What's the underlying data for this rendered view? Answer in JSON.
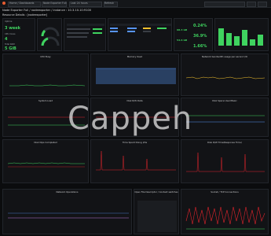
{
  "colors": {
    "green": "#3fd35f",
    "yellow": "#f2c12e",
    "red": "#e0242c",
    "orange": "#e65c30",
    "blue": "#5794f2",
    "purple": "#b877d9",
    "bg": "#0b0c0e",
    "panel": "#121316"
  },
  "topbar": {
    "items": [
      "Home / Dashboards",
      "Node Exporter Full",
      "Last 24 hours",
      "Refresh"
    ]
  },
  "breadcrumb": "Node Exporter Full  /  nodeexporter  /  instance : 10.3.10.10:9100",
  "row_title": "Resource Details : [nodeexporter]",
  "stats": {
    "uptime_label": "Uptime",
    "uptime_value": "3 week",
    "cpu_label": "CPU Cores",
    "cpu_value": "4",
    "ram_label": "Total RAM",
    "ram_value": "5 GiB",
    "pct1": "0.24%",
    "pct2": "36.9%",
    "pct3": "1.66%",
    "small1": "98.3 GB",
    "small2": "54.6 GB"
  },
  "panel_titles": [
    "CPU Busy",
    "Memory Used",
    "Network bandwidth usage per second I/O",
    "System Load",
    "Disk R/W Data",
    "Disk Space Used Basic",
    "Disk IOps Completed",
    "Time Spent Doing I/Os",
    "Disk R/W Time(Response Time)",
    "Network Operations",
    "Open File Descriptor / Context switches",
    "Socket / TCP Connections"
  ],
  "watermark": "Cappeh"
}
